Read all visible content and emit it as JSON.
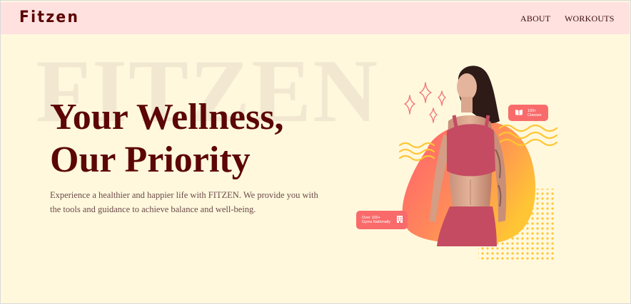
{
  "header": {
    "logo": "Fitzen",
    "nav": {
      "about": "ABOUT",
      "workouts": "WORKOUTS"
    }
  },
  "hero": {
    "watermark": "FITZEN",
    "headline_line1": "Your Wellness,",
    "headline_line2": "Our Priority",
    "description": "Experience a healthier and happier life with FITZEN. We provide you with the tools and guidance to achieve balance and well-being."
  },
  "badges": {
    "classes": {
      "line1": "100+",
      "line2": "Classes",
      "icon": "book-open-icon"
    },
    "gyms": {
      "line1": "Over 100+",
      "line2": "Gyms Nationally",
      "icon": "building-icon"
    }
  },
  "colors": {
    "background": "#fff8dd",
    "header_bg": "#ffe1df",
    "brand_dark": "#5c0606",
    "accent_coral": "#f96b6b",
    "accent_yellow": "#ffc634"
  }
}
